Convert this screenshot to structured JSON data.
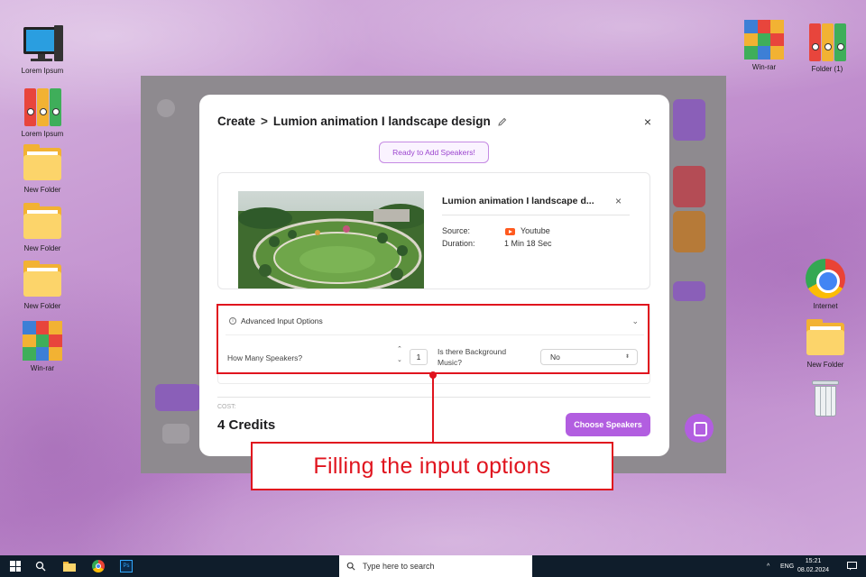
{
  "desktop": {
    "left_icons": [
      {
        "label": "Lorem Ipsum",
        "icon": "computer-icon"
      },
      {
        "label": "Lorem Ipsum",
        "icon": "binders-icon"
      },
      {
        "label": "New Folder",
        "icon": "folder-icon"
      },
      {
        "label": "New Folder",
        "icon": "folder-icon"
      },
      {
        "label": "New Folder",
        "icon": "folder-icon"
      },
      {
        "label": "Win-rar",
        "icon": "winrar-icon"
      }
    ],
    "right_icons": [
      {
        "label": "Win-rar",
        "icon": "winrar-icon"
      },
      {
        "label": "Folder (1)",
        "icon": "binders-icon"
      },
      {
        "label": "Internet",
        "icon": "chrome-icon"
      },
      {
        "label": "New Folder",
        "icon": "folder-icon"
      },
      {
        "label": "",
        "icon": "recycle-bin-icon"
      }
    ]
  },
  "modal": {
    "breadcrumb_root": "Create",
    "breadcrumb_sep": ">",
    "project_title": "Lumion animation I landscape design",
    "close_label": "×",
    "status_button": "Ready to Add Speakers!",
    "video": {
      "title": "Lumion animation I landscape d...",
      "remove_label": "×",
      "source_label": "Source:",
      "source_value": "Youtube",
      "duration_label": "Duration:",
      "duration_value": "1 Min 18 Sec"
    },
    "advanced": {
      "header": "Advanced Input Options",
      "info_glyph": "i",
      "chevron": "⌄",
      "speakers_label": "How Many Speakers?",
      "step_up": "⌃",
      "step_down": "⌄",
      "speakers_value": "1",
      "music_label_line1": "Is there Background",
      "music_label_line2": "Music?",
      "music_value": "No",
      "select_arrow": "⬍"
    },
    "cost_label": "COST:",
    "credits": "4 Credits",
    "choose_button": "Choose Speakers"
  },
  "annotation": {
    "callout_text": "Filling the input options",
    "color": "#e0141e"
  },
  "taskbar": {
    "search_placeholder": "Type here to search",
    "language": "ENG",
    "tray_arrow": "^",
    "time": "15:21",
    "date": "08.02.2024"
  },
  "colors": {
    "accent": "#b25ee0",
    "youtube": "#ff5a1f"
  }
}
